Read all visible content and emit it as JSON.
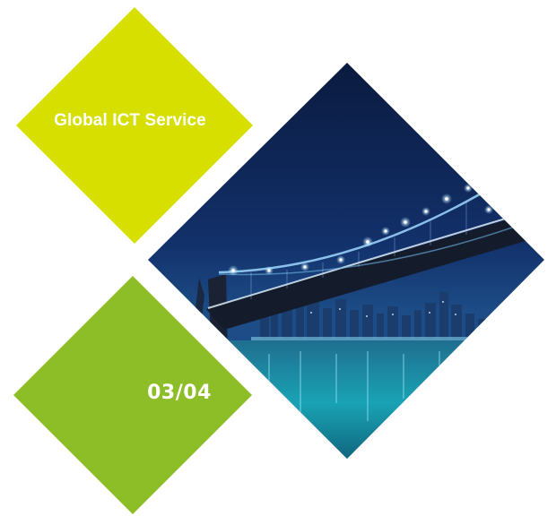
{
  "cover": {
    "title": "Global ICT Service",
    "page_indicator": "03/04"
  },
  "colors": {
    "lime_diamond": "#d6df00",
    "green_diamond": "#8dbd27",
    "night_sky": "#0f2a5c",
    "water": "#1b6f8a",
    "bridge_lights": "#e8f7ff"
  },
  "icons": {
    "photo": "bridge-night-photo"
  }
}
